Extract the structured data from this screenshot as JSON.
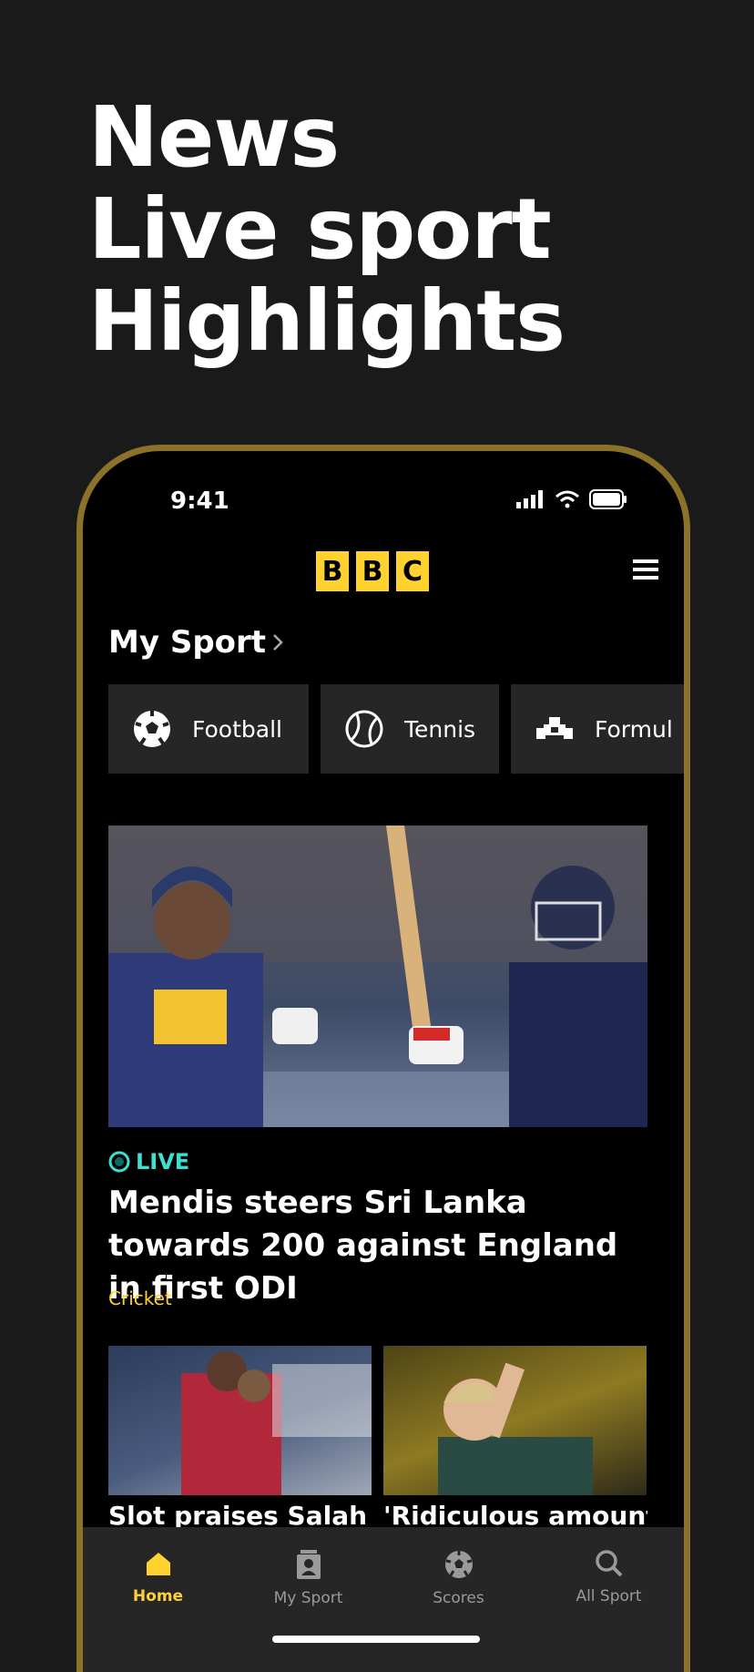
{
  "promo": {
    "line1": "News",
    "line2": "Live sport",
    "line3": "Highlights"
  },
  "status": {
    "time": "9:41"
  },
  "brand": {
    "b1": "B",
    "b2": "B",
    "b3": "C"
  },
  "my_sport": {
    "title": "My Sport",
    "chips": [
      {
        "label": "Football",
        "icon": "football-icon"
      },
      {
        "label": "Tennis",
        "icon": "tennis-icon"
      },
      {
        "label": "Formul",
        "icon": "formula1-car-icon"
      }
    ]
  },
  "hero": {
    "live_label": "LIVE",
    "title": "Mendis steers Sri Lanka towards 200 against England in first ODI",
    "tag": "Cricket"
  },
  "stories": [
    {
      "title": "Slot praises Salah"
    },
    {
      "title": "'Ridiculous amount of"
    }
  ],
  "tabs": [
    {
      "label": "Home",
      "icon": "home-icon"
    },
    {
      "label": "My Sport",
      "icon": "my-sport-icon"
    },
    {
      "label": "Scores",
      "icon": "scores-icon"
    },
    {
      "label": "All Sport",
      "icon": "search-icon"
    }
  ],
  "colors": {
    "accent": "#ffd230",
    "live": "#3de0d0",
    "frame": "#8c7228"
  }
}
